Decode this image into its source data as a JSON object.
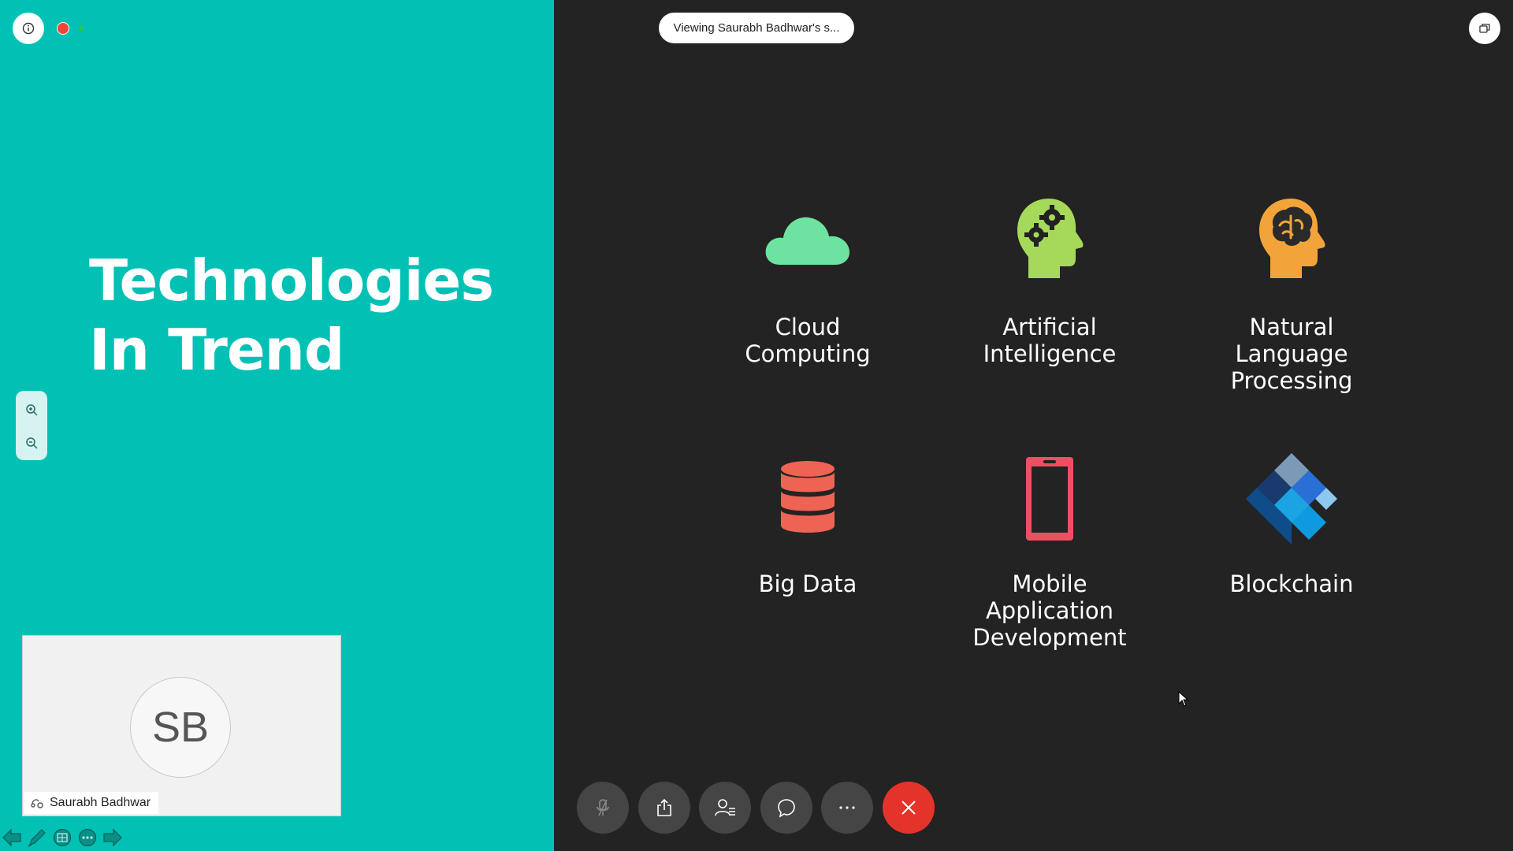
{
  "presentation": {
    "title_line1": "Technologies",
    "title_line2": "In Trend",
    "tiles": [
      {
        "label": "Cloud\nComputing",
        "icon": "cloud-icon",
        "color": "#6ee29f"
      },
      {
        "label": "Artificial\nIntelligence",
        "icon": "head-gears-icon",
        "color": "#a6d95a"
      },
      {
        "label": "Natural\nLanguage\nProcessing",
        "icon": "head-brain-icon",
        "color": "#f2a43a"
      },
      {
        "label": "Big Data",
        "icon": "database-icon",
        "color": "#ee6354"
      },
      {
        "label": "Mobile\nApplication\nDevelopment",
        "icon": "smartphone-icon",
        "color": "#ee4f63"
      },
      {
        "label": "Blockchain",
        "icon": "diamond-blocks-icon",
        "color": "#1ba3e2"
      }
    ],
    "colors": {
      "accent_teal": "#00c1b4",
      "background_dark": "#232323"
    }
  },
  "meeting": {
    "viewing_text": "Viewing Saurabh Badhwar's s...",
    "participant_name": "Saurabh Badhwar",
    "participant_initials": "SB",
    "recording_color": "#f2443a"
  },
  "controls": {
    "buttons": [
      "mute-microphone",
      "share-screen",
      "participants",
      "chat",
      "more-options",
      "end-call"
    ],
    "end_color": "#e4332a"
  }
}
